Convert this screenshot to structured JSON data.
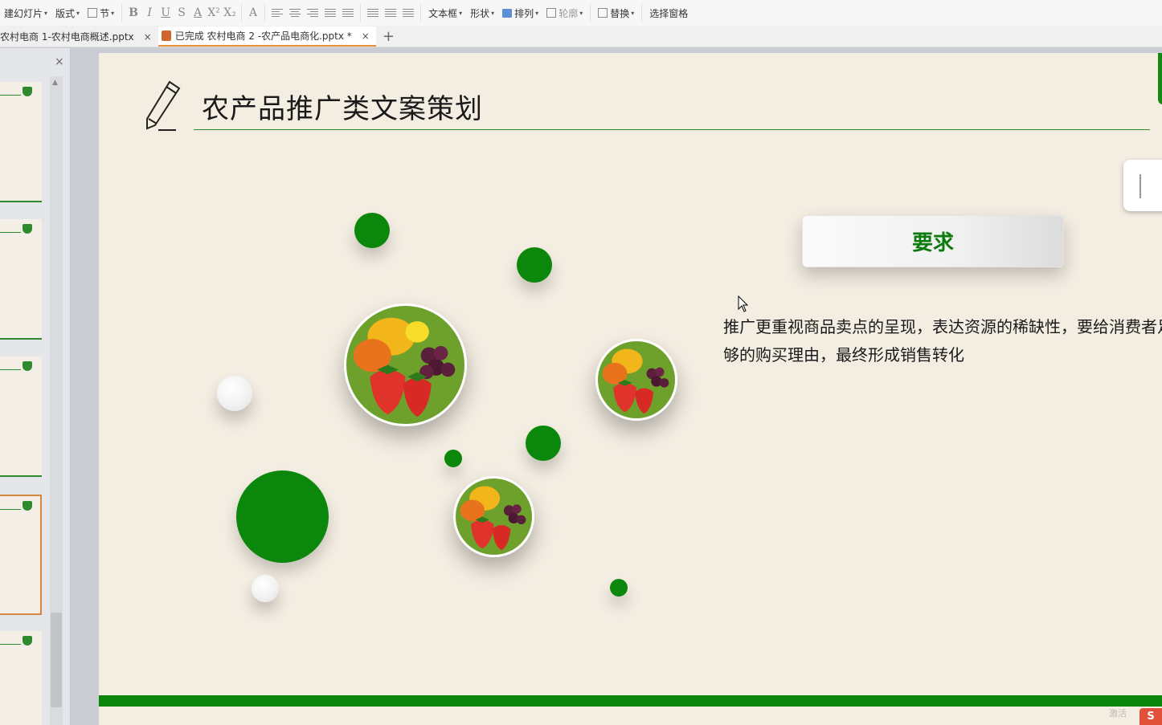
{
  "toolbar": {
    "new_slide": "建幻灯片",
    "layout": "版式",
    "section": "节",
    "text_box": "文本框",
    "shape": "形状",
    "arrange": "排列",
    "outline": "轮廓",
    "replace": "替换",
    "select_pane": "选择窗格"
  },
  "tabs": [
    {
      "label": "农村电商 1-农村电商概述.pptx",
      "close": "×"
    },
    {
      "label": "已完成 农村电商 2 -农产品电商化.pptx *",
      "close": "×"
    }
  ],
  "new_tab": "+",
  "thumb_close": "×",
  "slide": {
    "title": "农产品推广类文案策划",
    "requirement_label": "要求",
    "requirement_body": "推广更重视商品卖点的呈现，表达资源的稀缺性，要给消费者足够的购买理由，最终形成销售转化"
  },
  "colors": {
    "accent_green": "#0b870b",
    "slide_bg": "#f3ede2",
    "tab_active_underline": "#e8913a"
  },
  "watermark": "激活",
  "watermark_logo": "S"
}
